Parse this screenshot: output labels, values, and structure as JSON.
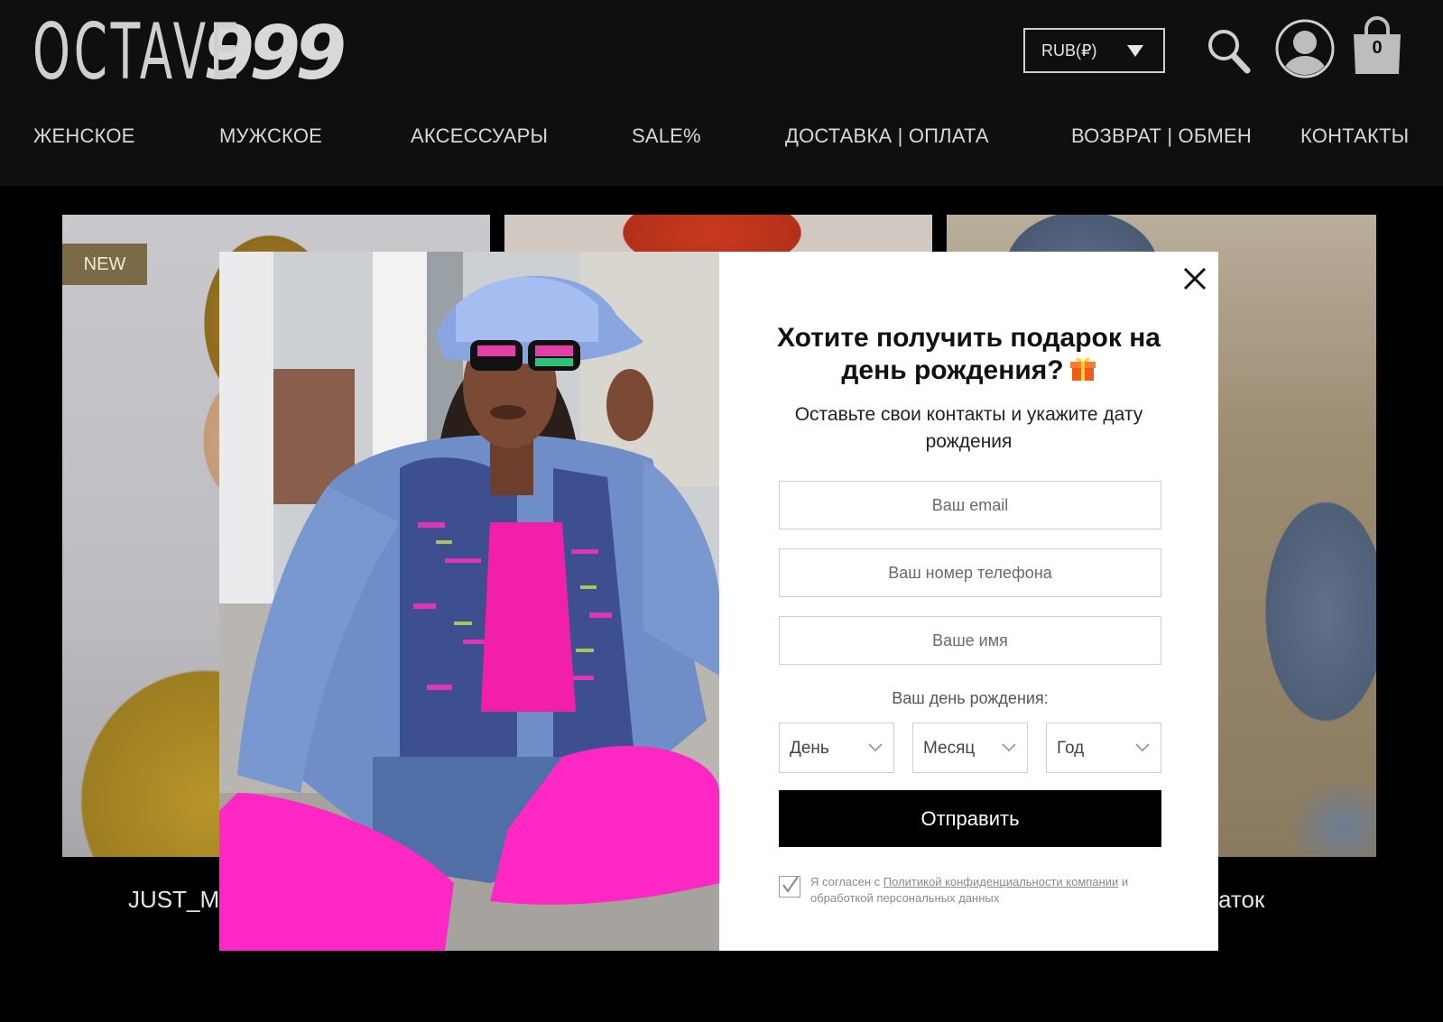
{
  "header": {
    "logo": {
      "word": "OCTAVE",
      "number": "999"
    },
    "currency": "RUB(₽)",
    "cart_count": "0",
    "nav": [
      "ЖЕНСКОЕ",
      "МУЖСКОЕ",
      "АКСЕССУАРЫ",
      "SALE%",
      "ДОСТАВКА | ОПЛАТА",
      "ВОЗВРАТ | ОБМЕН",
      "КОНТАКТЫ"
    ]
  },
  "products": {
    "badge": "NEW",
    "captions": [
      "JUST_M",
      "аток"
    ]
  },
  "modal": {
    "title_line1": "Хотите получить подарок на",
    "title_line2": "день рождения?",
    "subtitle": "Оставьте свои контакты и укажите дату рождения",
    "email_placeholder": "Ваш email",
    "phone_placeholder": "Ваш номер телефона",
    "name_placeholder": "Ваше имя",
    "birthday_label": "Ваш день рождения:",
    "day": "День",
    "month": "Месяц",
    "year": "Год",
    "submit": "Отправить",
    "consent_prefix": "Я согласен с ",
    "consent_link1": "Политикой конфиденциальности компании",
    "consent_middle": " и обработкой персональных данных",
    "consent_checked": true
  },
  "colors": {
    "header_bg": "#0f0f0f",
    "page_bg": "#000000",
    "submit_bg": "#000000",
    "badge_bg": "#7a6a45"
  },
  "icons": [
    "search-icon",
    "user-icon",
    "cart-icon",
    "close-icon",
    "gift-icon",
    "chevron-down-icon",
    "checkmark-icon"
  ]
}
